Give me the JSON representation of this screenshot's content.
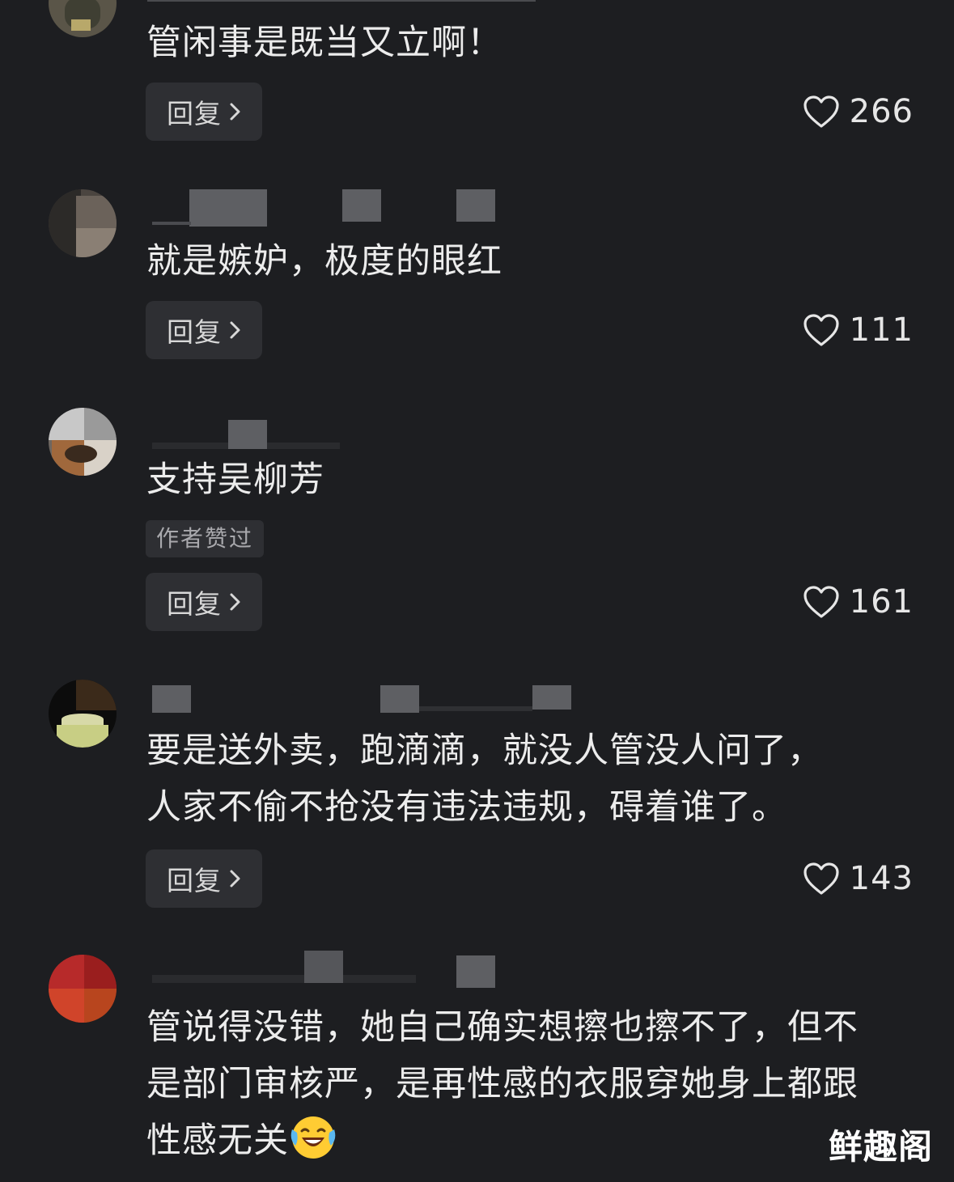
{
  "comments": [
    {
      "text": "管闲事是既当又立啊！",
      "reply_label": "回复",
      "likes": "266"
    },
    {
      "text": "就是嫉妒，极度的眼红",
      "reply_label": "回复",
      "likes": "111"
    },
    {
      "text": "支持吴柳芳",
      "badge": "作者赞过",
      "reply_label": "回复",
      "likes": "161"
    },
    {
      "text": "要是送外卖，跑滴滴，就没人管没人问了，\n人家不偷不抢没有违法违规，碍着谁了。",
      "reply_label": "回复",
      "likes": "143"
    },
    {
      "text": "管说得没错，她自己确实想擦也擦不了，但不\n是部门审核严，是再性感的衣服穿她身上都跟\n性感无关",
      "emoji": "laughing-with-tears"
    }
  ],
  "icons": {
    "like": "heart-outline-icon",
    "reply_arrow": "chevron-right-icon"
  },
  "watermark": "鲜趣阁",
  "colors": {
    "background": "#1d1e21",
    "button_bg": "#2e2f33",
    "text": "#ececec",
    "muted": "#a9a9ad"
  }
}
